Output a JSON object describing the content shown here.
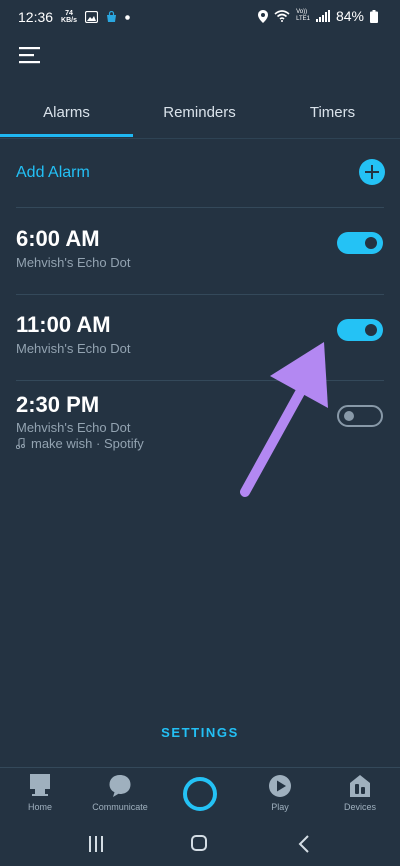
{
  "status_bar": {
    "time": "12:36",
    "speed_value": "74",
    "speed_unit": "KB/s",
    "volte_top": "Vo))",
    "volte_bottom": "LTE1",
    "battery": "84%"
  },
  "tabs": [
    {
      "label": "Alarms",
      "active": true
    },
    {
      "label": "Reminders",
      "active": false
    },
    {
      "label": "Timers",
      "active": false
    }
  ],
  "add_alarm_label": "Add Alarm",
  "alarms": [
    {
      "time": "6:00 AM",
      "device": "Mehvish's Echo Dot",
      "enabled": true
    },
    {
      "time": "11:00 AM",
      "device": "Mehvish's Echo Dot",
      "enabled": true
    },
    {
      "time": "2:30 PM",
      "device": "Mehvish's Echo Dot",
      "music": "make wish · Spotify",
      "enabled": false
    }
  ],
  "settings_label": "SETTINGS",
  "bottom_nav": [
    {
      "label": "Home",
      "icon": "home-icon"
    },
    {
      "label": "Communicate",
      "icon": "chat-icon"
    },
    {
      "label": "",
      "icon": "alexa-icon"
    },
    {
      "label": "Play",
      "icon": "play-icon"
    },
    {
      "label": "Devices",
      "icon": "devices-icon"
    }
  ],
  "colors": {
    "background": "#243342",
    "accent": "#24c2f5",
    "annotation_arrow": "#b388f2"
  }
}
